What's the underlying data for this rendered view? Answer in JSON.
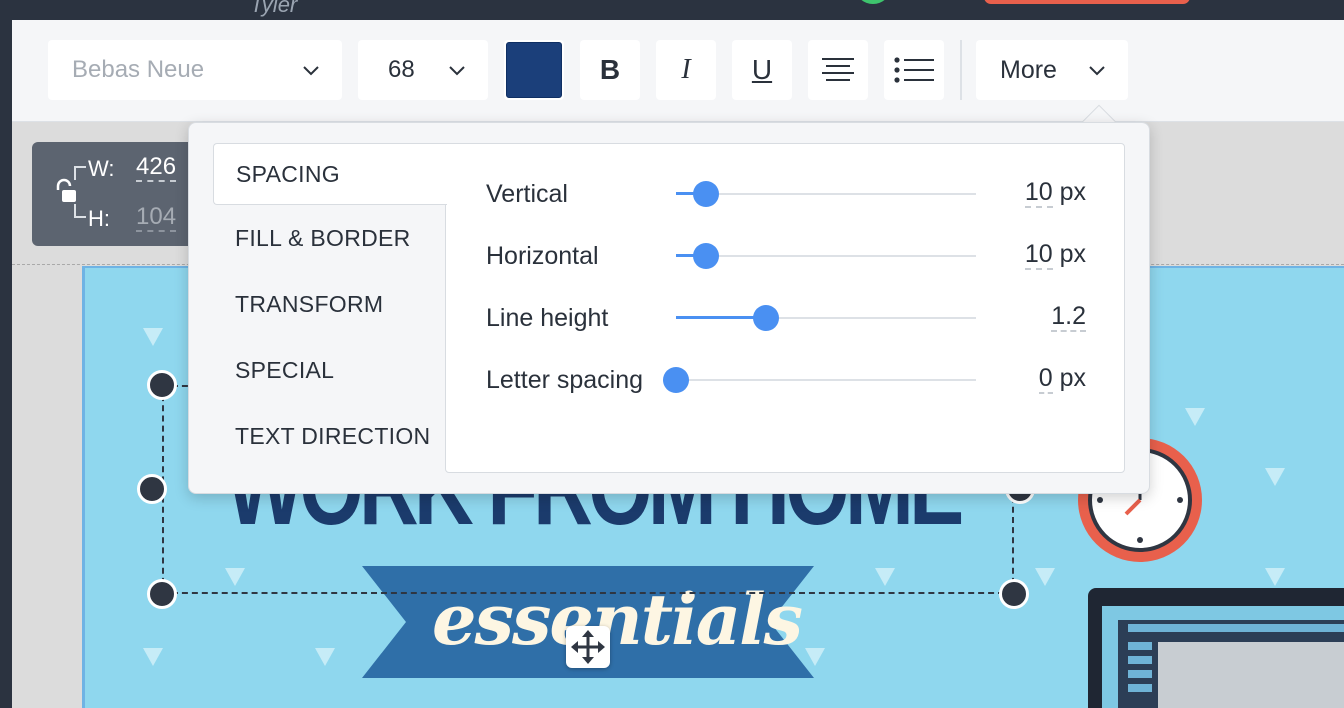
{
  "window": {
    "user_name": "Tyler"
  },
  "toolbar": {
    "font_family": "Bebas Neue",
    "font_size": "68",
    "text_color": "#1b3f7a",
    "bold_label": "B",
    "italic_label": "I",
    "underline_label": "U",
    "more_label": "More"
  },
  "dimensions": {
    "width_label": "W:",
    "width_value": "426",
    "height_label": "H:",
    "height_value": "104"
  },
  "popover": {
    "tabs": [
      {
        "label": "SPACING",
        "active": true
      },
      {
        "label": "FILL & BORDER",
        "active": false
      },
      {
        "label": "TRANSFORM",
        "active": false
      },
      {
        "label": "SPECIAL",
        "active": false
      },
      {
        "label": "TEXT DIRECTION",
        "active": false
      }
    ],
    "spacing": [
      {
        "label": "Vertical",
        "value": "10",
        "unit": "px",
        "level": 0.1
      },
      {
        "label": "Horizontal",
        "value": "10",
        "unit": "px",
        "level": 0.1
      },
      {
        "label": "Line height",
        "value": "1.2",
        "unit": "",
        "level": 0.3
      },
      {
        "label": "Letter spacing",
        "value": "0",
        "unit": "px",
        "level": 0.0
      }
    ]
  },
  "canvas": {
    "headline": "WORK FROM HOME",
    "ribbon_text": "essentials"
  },
  "colors": {
    "accent": "#4a90f2",
    "canvas_background": "#8fd7ee",
    "headline": "#1b3b6c",
    "ribbon": "#2f6fa8"
  }
}
